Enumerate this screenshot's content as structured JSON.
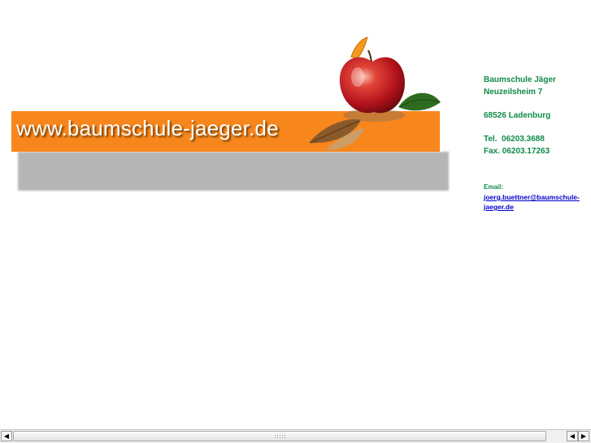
{
  "banner": {
    "url_text": "www.baumschule-jaeger.de",
    "accent_color": "#f7861d"
  },
  "contact": {
    "company": "Baumschule Jäger",
    "street": "Neuzeilsheim 7",
    "city": "68526 Ladenburg",
    "tel": "Tel.  06203.3688",
    "fax": "Fax. 06203.17263",
    "email_label": "Email:",
    "email_line1": "joerg.buettner@baumschule-",
    "email_line2": "jaeger.de",
    "text_color": "#0f8a4a",
    "link_color": "#0000cc"
  },
  "scrollbar": {
    "left_icon": "arrow-left-icon",
    "right_icon_a": "arrow-left-icon",
    "right_icon_b": "arrow-right-icon"
  }
}
